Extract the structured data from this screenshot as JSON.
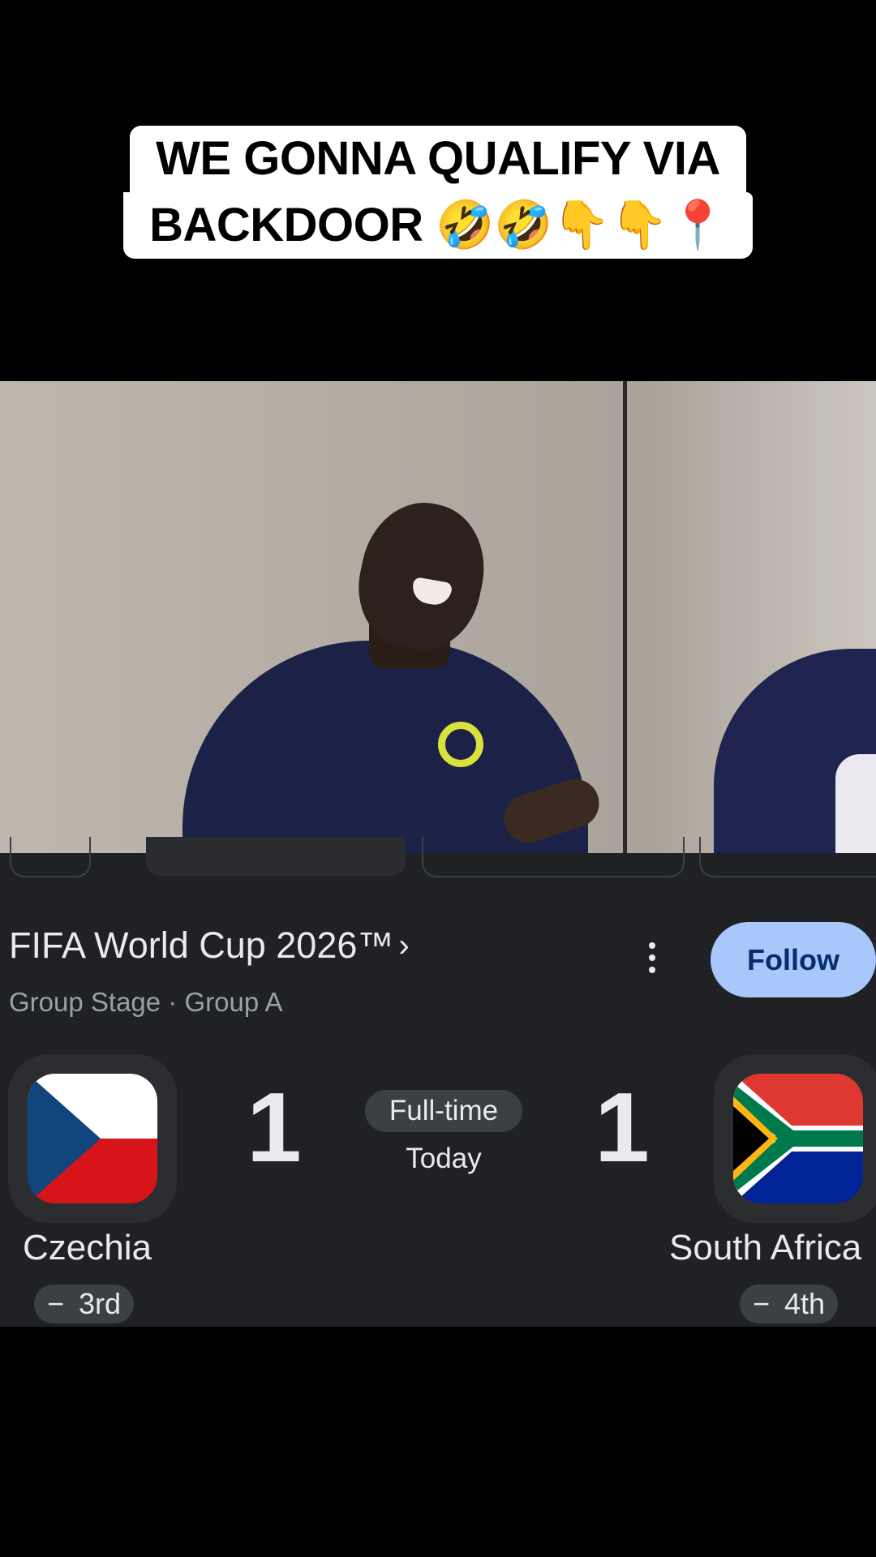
{
  "caption": {
    "line1": "WE GONNA QUALIFY VIA",
    "line2": "BACKDOOR 🤣🤣👇👇📍"
  },
  "match_card": {
    "league": "FIFA World Cup 2026™",
    "league_chevron": "›",
    "stage": "Group Stage · Group A",
    "follow_label": "Follow",
    "more_icon": "more-vert-icon",
    "status": "Full-time",
    "date": "Today",
    "home": {
      "name": "Czechia",
      "score": "1",
      "rank": "3rd",
      "rank_change": "−",
      "flag": "czechia-flag"
    },
    "away": {
      "name": "South Africa",
      "score": "1",
      "rank": "4th",
      "rank_change": "−",
      "flag": "south-africa-flag"
    },
    "colors": {
      "card_bg": "#1f2124",
      "follow_bg": "#a8c7fa",
      "follow_text": "#062e6f",
      "muted": "#9aa0a6"
    }
  }
}
